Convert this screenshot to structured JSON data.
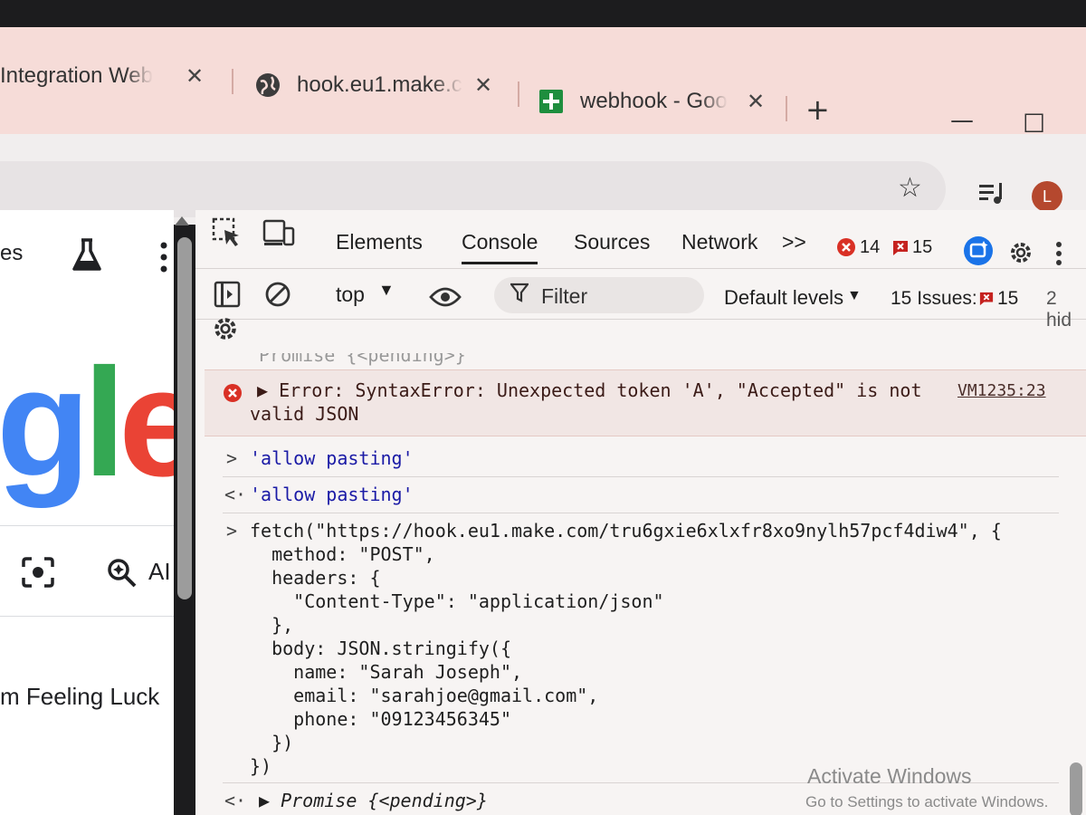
{
  "tabs": [
    {
      "title": "Integration Web",
      "icon": "none"
    },
    {
      "title": "hook.eu1.make.c",
      "icon": "globe-icon"
    },
    {
      "title": "webhook - Goo",
      "icon": "sheets-icon"
    }
  ],
  "tab_close_symbol": "✕",
  "new_tab_symbol": "+",
  "window": {
    "minimize": "—",
    "maximize": "☐"
  },
  "profile": {
    "initial": "L",
    "color": "#b5482e"
  },
  "left_page": {
    "top_text": "es",
    "logo_letters": [
      "g",
      "l",
      "e"
    ],
    "logo_colors": [
      "#4285f4",
      "#34a853",
      "#ea4335"
    ],
    "ai_label": "AI",
    "lucky_button": "m Feeling Luck"
  },
  "devtools": {
    "tabs": [
      "Elements",
      "Console",
      "Sources",
      "Network"
    ],
    "more_tabs": ">>",
    "errors_count": "14",
    "warnings_count": "15",
    "context": "top",
    "filter_placeholder": "Filter",
    "levels": "Default levels",
    "issues_label": "15 Issues:",
    "issues_count": "15",
    "hidden_label": "2 hid"
  },
  "console": {
    "partial_top": "Promise {<pending>}",
    "error_text_1": "▶ Error: SyntaxError: Unexpected token 'A', \"Accepted\" is not",
    "error_text_2": "valid JSON",
    "error_link": "VM1235:23",
    "input1": "'allow pasting'",
    "output1": "'allow pasting'",
    "code_lines": [
      "fetch(\"https://hook.eu1.make.com/tru6gxie6xlxfr8xo9nylh57pcf4diw4\", {",
      "  method: \"POST\",",
      "  headers: {",
      "    \"Content-Type\": \"application/json\"",
      "  },",
      "  body: JSON.stringify({",
      "    name: \"Sarah Joseph\",",
      "    email: \"sarahjoe@gmail.com\",",
      "    phone: \"09123456345\"",
      "  })",
      "})"
    ],
    "result": "▶ Promise {<pending>}"
  },
  "watermark": {
    "line1": "Activate Windows",
    "line2": "Go to Settings to activate Windows."
  },
  "colors": {
    "tabstrip": "#f6dcd8",
    "devtools_bg": "#f7f4f3",
    "error_red": "#d93025"
  }
}
